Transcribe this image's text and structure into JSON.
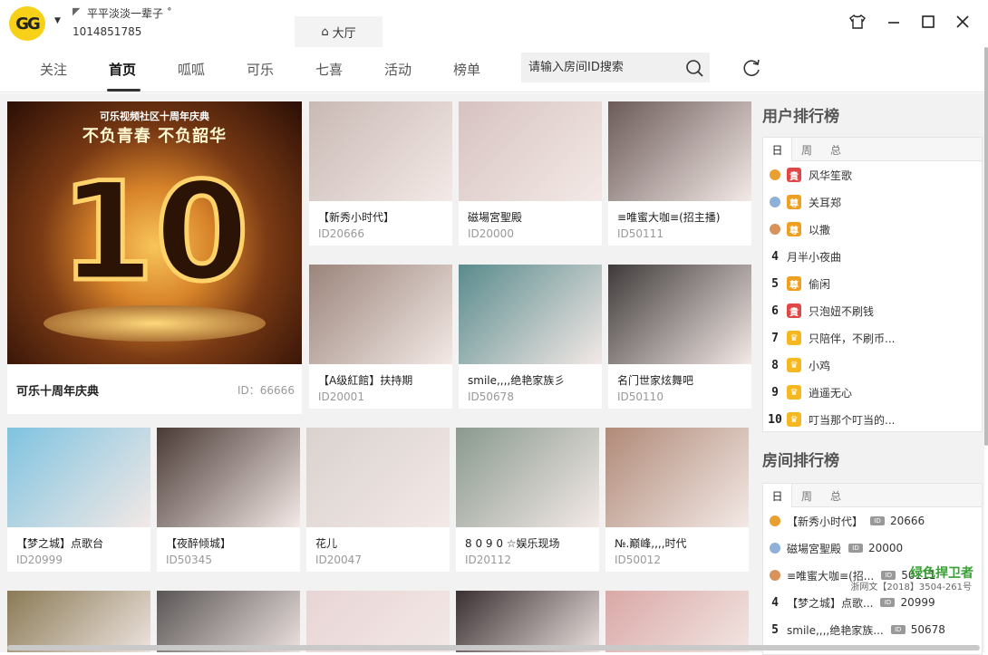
{
  "title_bar": {
    "logo_text": "GG",
    "username": "平平淡淡一辈子 ˚",
    "user_id": "1014851785",
    "hall_tab": "大厅",
    "buttons": [
      "skin",
      "minimize",
      "maximize",
      "close"
    ]
  },
  "nav": {
    "items": [
      "关注",
      "首页",
      "呱呱",
      "可乐",
      "七喜",
      "活动",
      "榜单"
    ],
    "active": "首页",
    "search_placeholder": "请输入房间ID搜索"
  },
  "featured": {
    "title": "可乐十周年庆典",
    "id": "ID：66666",
    "banner_top": "可乐视频社区十周年庆典",
    "banner_sub": "不负青春 不负韶华",
    "banner_num": "10"
  },
  "rooms_row1": [
    {
      "title": "【新秀小时代】",
      "id": "ID20666",
      "color": "#c9b9b4"
    },
    {
      "title": "磁場宮聖殿",
      "id": "ID20000",
      "color": "#d7c3c1"
    },
    {
      "title": "≡唯蜜大咖≡(招主播)",
      "id": "ID50111",
      "color": "#6b5a58"
    }
  ],
  "rooms_row2": [
    {
      "title": "【A级紅館】扶持期",
      "id": "ID20001",
      "color": "#9b857b"
    },
    {
      "title": "smile,,,,绝艳家族彡",
      "id": "ID50678",
      "color": "#5a8b8d"
    },
    {
      "title": "名门世家炫舞吧",
      "id": "ID50110",
      "color": "#3f3a3a"
    }
  ],
  "rooms_row3": [
    {
      "title": "【梦之城】点歌台",
      "id": "ID20999",
      "color": "#7fc3e0"
    },
    {
      "title": "【夜醉倾城】",
      "id": "ID50345",
      "color": "#4a3a35"
    },
    {
      "title": "花儿",
      "id": "ID20047",
      "color": "#d9d2cf"
    },
    {
      "title": "8 0 9 0 ☆娱乐现场",
      "id": "ID20112",
      "color": "#8a9a8e"
    },
    {
      "title": "№.巅峰,,,,时代",
      "id": "ID50012",
      "color": "#b08a78"
    }
  ],
  "rooms_row4": [
    {
      "color": "#8a7a55"
    },
    {
      "color": "#5a5555"
    },
    {
      "color": "#e8d5d5"
    },
    {
      "color": "#3a3032"
    },
    {
      "color": "#d9a8a6"
    }
  ],
  "user_rank": {
    "title": "用户排行榜",
    "tabs": [
      "日",
      "周",
      "总"
    ],
    "rows": [
      {
        "rank": "1",
        "badge": "貴",
        "badge_color": "#e04848",
        "name": "风华笙歌"
      },
      {
        "rank": "2",
        "badge": "尊",
        "badge_color": "#f0a020",
        "name": "关耳郑"
      },
      {
        "rank": "3",
        "badge": "尊",
        "badge_color": "#f0a020",
        "name": "以撒"
      },
      {
        "rank": "4",
        "badge": "",
        "badge_color": "",
        "name": "月半小夜曲"
      },
      {
        "rank": "5",
        "badge": "尊",
        "badge_color": "#f0a020",
        "name": "偷闲"
      },
      {
        "rank": "6",
        "badge": "貴",
        "badge_color": "#e04848",
        "name": "只泡妞不刷钱"
      },
      {
        "rank": "7",
        "badge": "♛",
        "badge_color": "#f5b820",
        "name": "只陪伴，不刷币..."
      },
      {
        "rank": "8",
        "badge": "♛",
        "badge_color": "#f5b820",
        "name": "小鸡"
      },
      {
        "rank": "9",
        "badge": "♛",
        "badge_color": "#f5b820",
        "name": "逍遥无心"
      },
      {
        "rank": "10",
        "badge": "♛",
        "badge_color": "#f5b820",
        "name": "叮当那个叮当的..."
      }
    ]
  },
  "room_rank": {
    "title": "房间排行榜",
    "tabs": [
      "日",
      "周",
      "总"
    ],
    "rows": [
      {
        "rank": "1",
        "name": "【新秀小时代】",
        "id": "20666"
      },
      {
        "rank": "2",
        "name": "磁場宮聖殿",
        "id": "20000"
      },
      {
        "rank": "3",
        "name": "≡唯蜜大咖≡(招...",
        "id": "50111"
      },
      {
        "rank": "4",
        "name": "【梦之城】点歌...",
        "id": "20999"
      },
      {
        "rank": "5",
        "name": "smile,,,,绝艳家族...",
        "id": "50678"
      }
    ]
  },
  "watermark": {
    "site": "绿色捍卫者",
    "license": "浙网文【2018】3504-261号"
  }
}
